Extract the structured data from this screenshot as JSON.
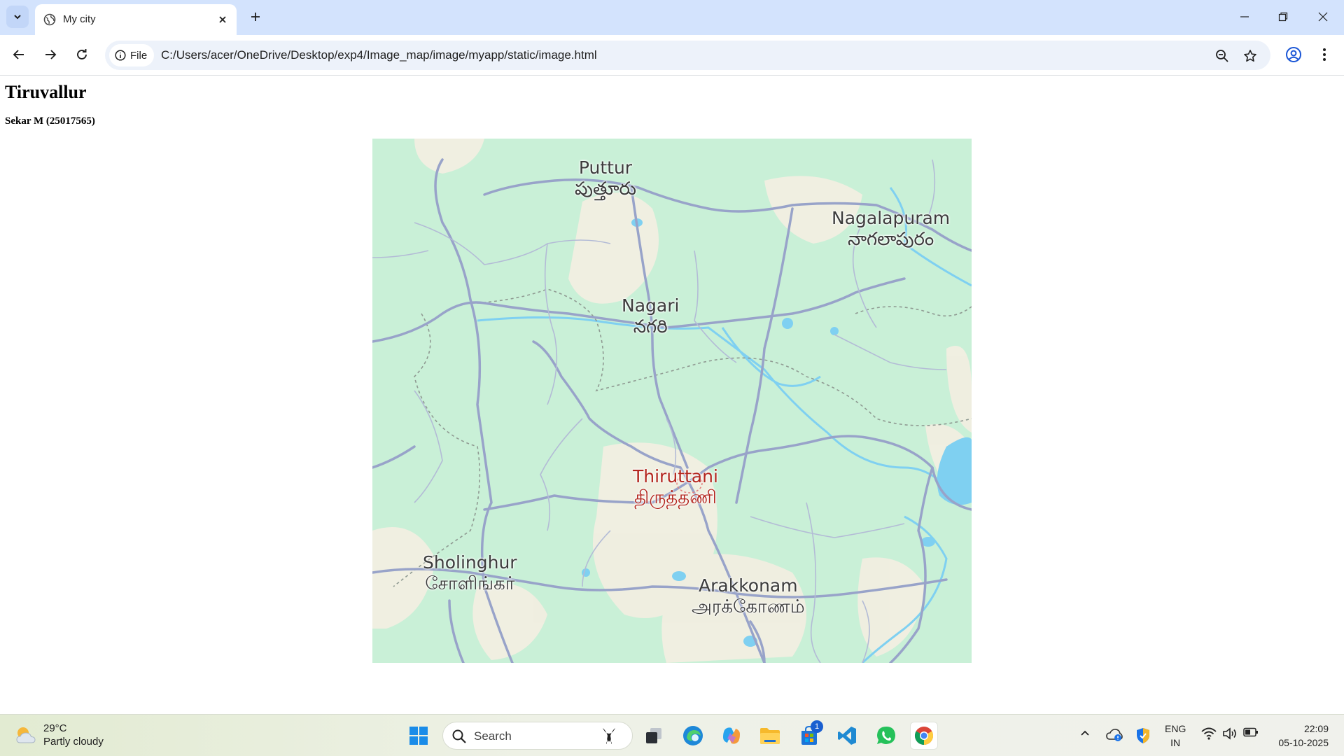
{
  "browser": {
    "tab": {
      "title": "My city"
    },
    "address_bar": {
      "site_chip_label": "File",
      "url": "C:/Users/acer/OneDrive/Desktop/exp4/Image_map/image/myapp/static/image.html"
    }
  },
  "page": {
    "heading": "Tiruvallur",
    "subheading": "Sekar M (25017565)"
  },
  "map": {
    "places": [
      {
        "id": "puttur",
        "name": "Puttur",
        "local_name": "పుత్తూరు"
      },
      {
        "id": "nagalapuram",
        "name": "Nagalapuram",
        "local_name": "నాగలాపురం"
      },
      {
        "id": "nagari",
        "name": "Nagari",
        "local_name": "నగరి"
      },
      {
        "id": "thiruttani",
        "name": "Thiruttani",
        "local_name": "திருத்தணி",
        "highlight": true,
        "color": "#b3261e"
      },
      {
        "id": "sholinghur",
        "name": "Sholinghur",
        "local_name": "சோளிங்கர்"
      },
      {
        "id": "arakkonam",
        "name": "Arakkonam",
        "local_name": "அரக்கோணம்"
      }
    ],
    "colors": {
      "land": "#c8f0d6",
      "urban": "#f3eedf",
      "road": "#9aa4c8",
      "water": "#7ecff0"
    }
  },
  "taskbar": {
    "weather": {
      "temperature": "29°C",
      "condition": "Partly cloudy"
    },
    "search_label": "Search",
    "store_badge": "1",
    "language": {
      "line1": "ENG",
      "line2": "IN"
    },
    "clock": {
      "time": "22:09",
      "date": "05-10-2025"
    }
  }
}
